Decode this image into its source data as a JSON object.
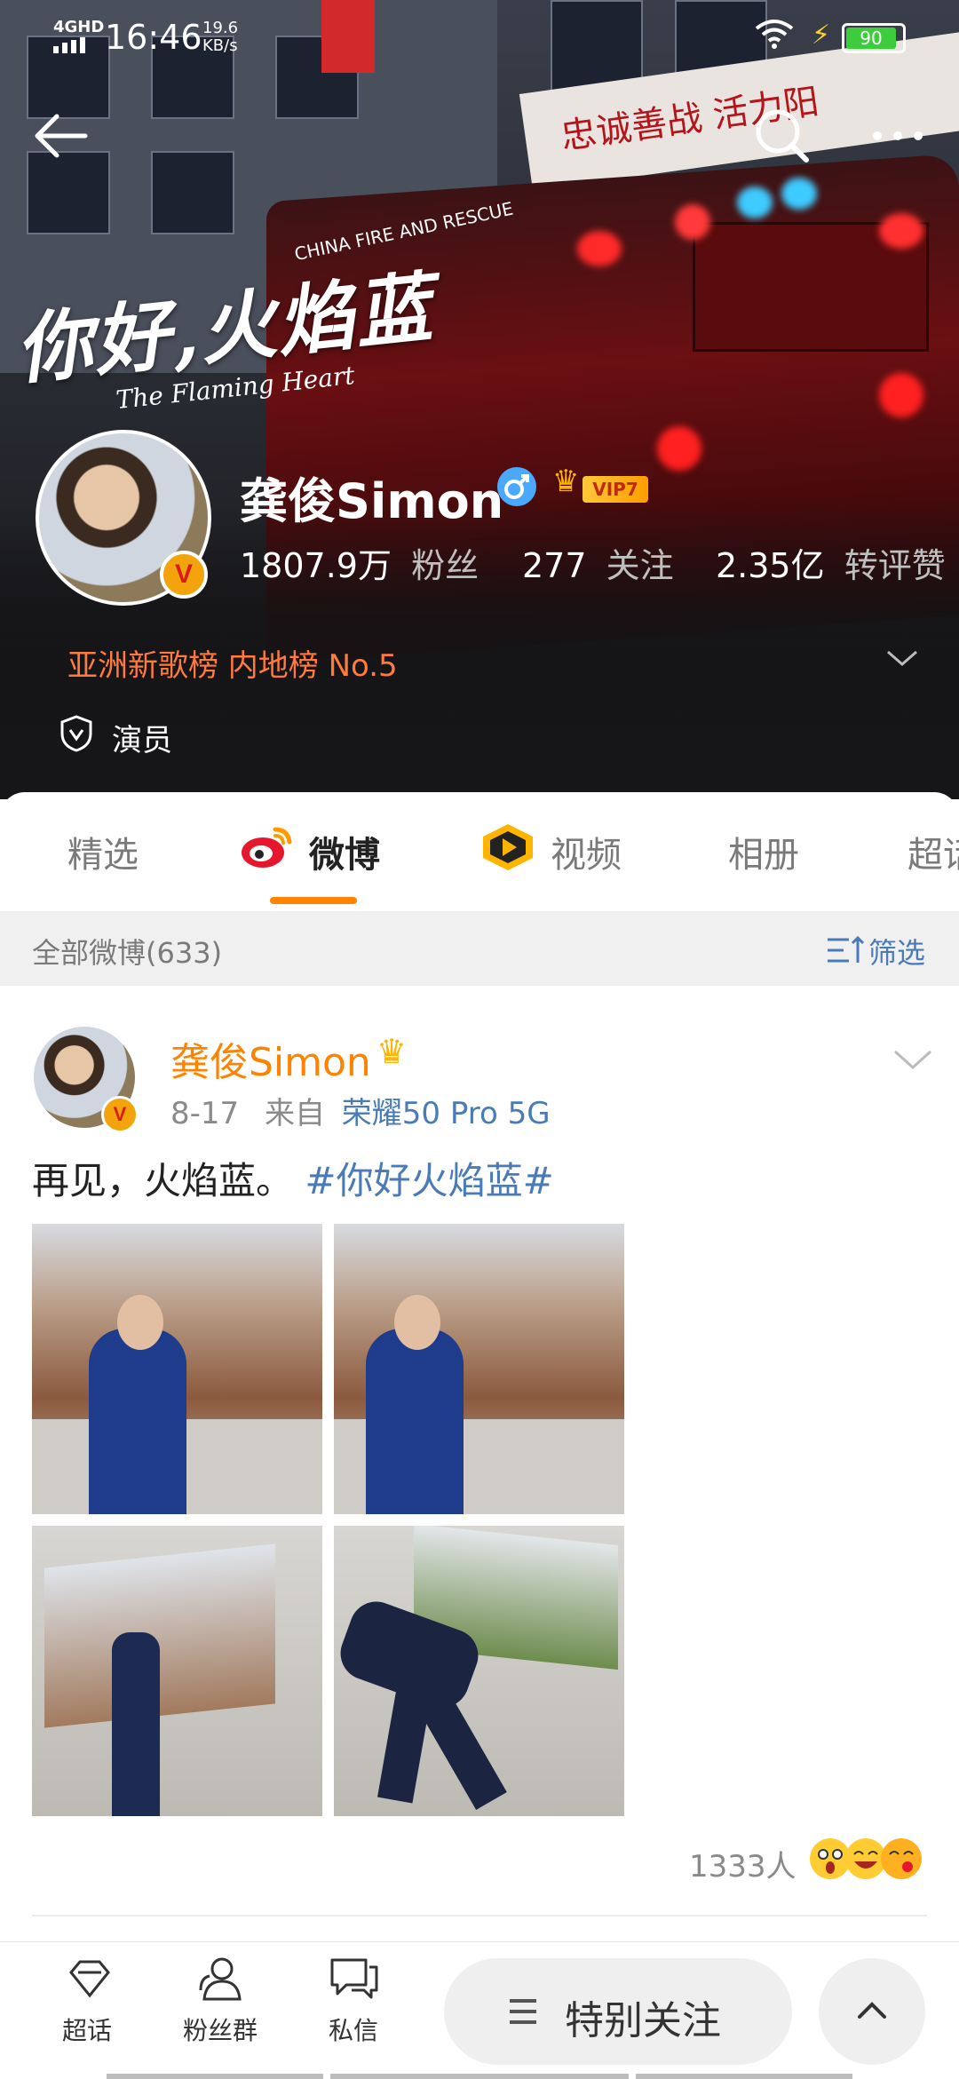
{
  "status_bar": {
    "network": "4GHD",
    "time": "16:46",
    "speed_value": "19.6",
    "speed_unit": "KB/s",
    "battery": "90"
  },
  "header": {
    "hero_title": "你好,火焰蓝",
    "hero_subtitle": "The Flaming Heart",
    "truck_text": "CHINA FIRE AND RESCUE",
    "banner_text": "忠诚善战 活力阳",
    "profile": {
      "name": "龚俊Simon",
      "gender_icon": "male-icon",
      "vip_label": "VIP7",
      "verified_badge": "V",
      "stats": [
        {
          "value": "1807.9万",
          "label": "粉丝"
        },
        {
          "value": "277",
          "label": "关注"
        },
        {
          "value": "2.35亿",
          "label": "转评赞"
        }
      ],
      "chart_rank": "亚洲新歌榜 内地榜 No.5",
      "role": "演员"
    }
  },
  "tabs": [
    {
      "label": "精选",
      "active": false
    },
    {
      "label": "微博",
      "active": true
    },
    {
      "label": "视频",
      "active": false
    },
    {
      "label": "相册",
      "active": false
    },
    {
      "label": "超话",
      "active": false
    }
  ],
  "filter": {
    "count_label": "全部微博(633)",
    "filter_label": "筛选"
  },
  "post": {
    "author": "龚俊Simon",
    "date": "8-17",
    "source_prefix": "来自",
    "source": "荣耀50 Pro 5G",
    "text_plain": "再见，火焰蓝。",
    "text_tag": "#你好火焰蓝#",
    "reactions_count": "1333人"
  },
  "bottom_bar": {
    "items": [
      {
        "label": "超话",
        "icon": "diamond-icon"
      },
      {
        "label": "粉丝群",
        "icon": "fans-group-icon"
      },
      {
        "label": "私信",
        "icon": "message-icon"
      }
    ],
    "follow_button": "特别关注"
  },
  "colors": {
    "accent_orange": "#ff8200",
    "link_blue": "#4a7bb7",
    "rank_orange": "#ff7a3d"
  }
}
